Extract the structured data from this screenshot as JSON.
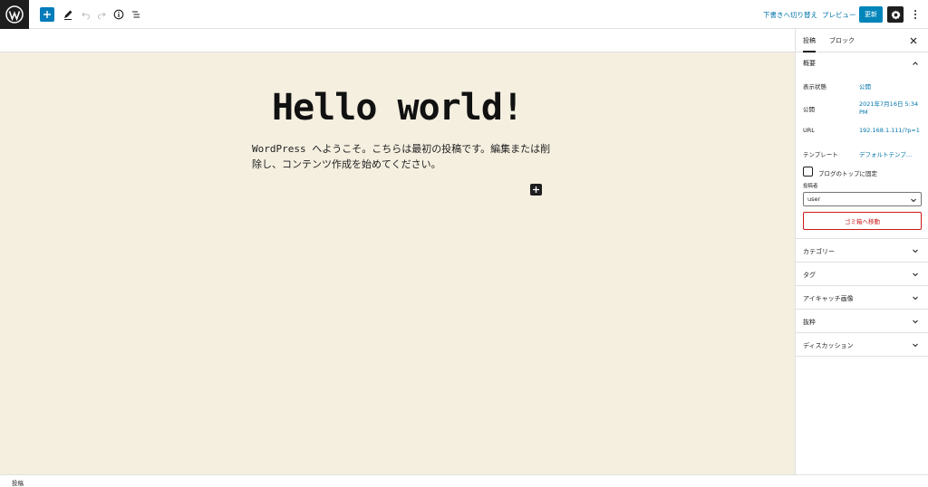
{
  "toolbar": {
    "switch_to_draft": "下書きへ切り替え",
    "preview": "プレビュー",
    "update": "更新"
  },
  "post": {
    "title": "Hello world!",
    "content": "WordPress へようこそ。こちらは最初の投稿です。編集または削除し、コンテンツ作成を始めてください。"
  },
  "sidebar": {
    "tabs": [
      "投稿",
      "ブロック"
    ],
    "summary": {
      "heading": "概要",
      "visibility_label": "表示状態",
      "visibility_value": "公開",
      "publish_label": "公開",
      "publish_value": "2021年7月16日 5:34 PM",
      "url_label": "URL",
      "url_value": "192.168.1.111/?p=1",
      "template_label": "テンプレート",
      "template_value": "デフォルトテンプ…",
      "sticky_label": "ブログのトップに固定",
      "author_label": "投稿者",
      "author_value": "user",
      "trash_button": "ゴミ箱へ移動"
    },
    "panels": [
      "カテゴリー",
      "タグ",
      "アイキャッチ画像",
      "抜粋",
      "ディスカッション"
    ]
  },
  "footer": {
    "breadcrumb": "投稿"
  },
  "colors": {
    "accent": "#007cba",
    "canvas_bg": "#f5efe0",
    "danger": "#cc1818"
  }
}
